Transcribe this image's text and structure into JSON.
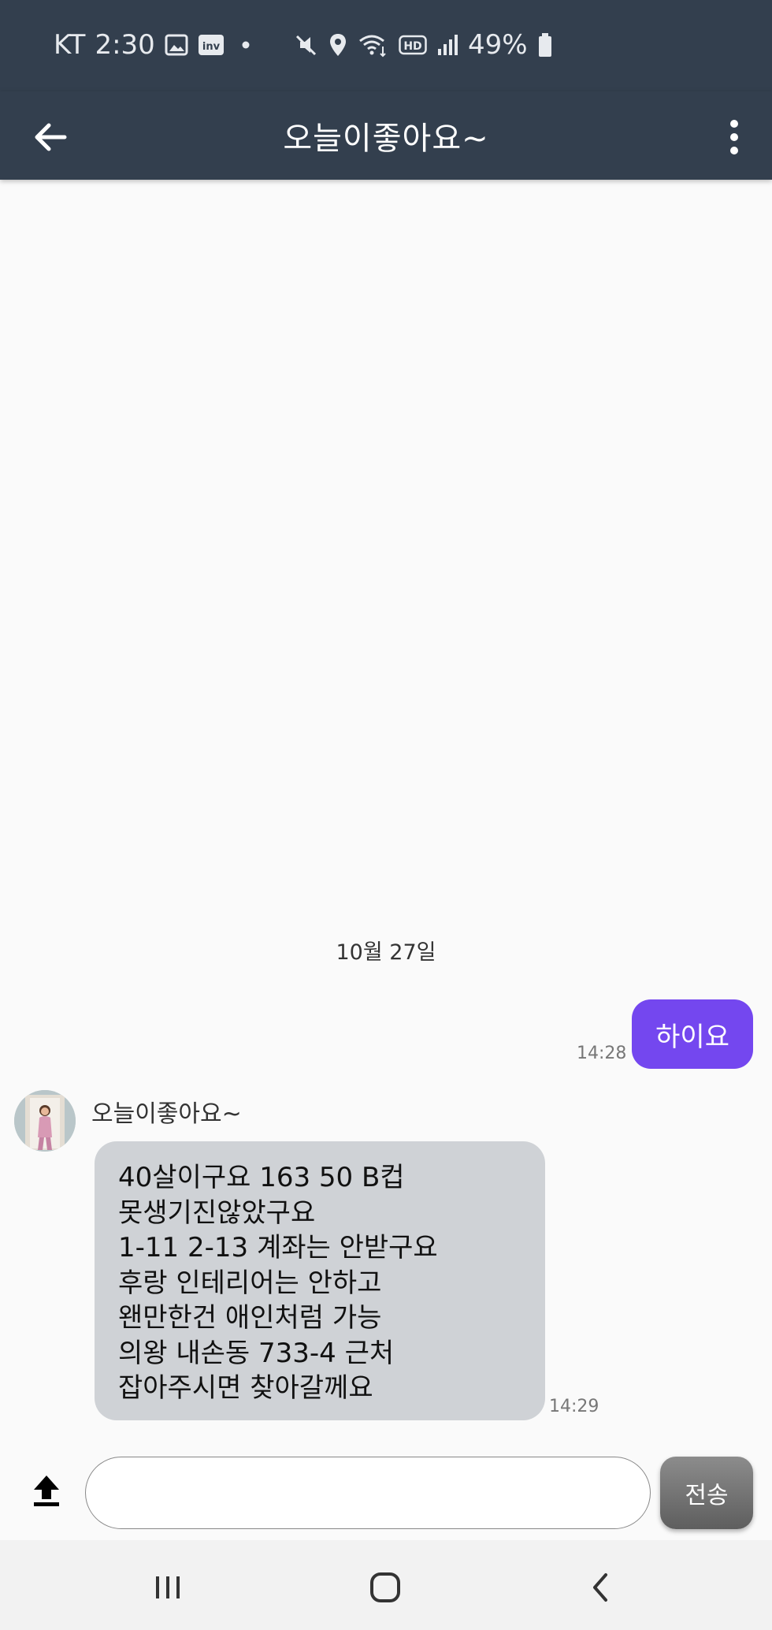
{
  "status_bar": {
    "carrier": "KT",
    "time": "2:30",
    "battery_percent": "49%",
    "icons": [
      "gallery-icon",
      "inv-app-icon",
      "dot-icon",
      "mute-icon",
      "location-icon",
      "wifi-icon",
      "hd-voice-icon",
      "signal-icon",
      "battery-icon"
    ]
  },
  "app_bar": {
    "title": "오늘이좋아요~",
    "icons": [
      "back-arrow-icon",
      "more-vertical-icon"
    ]
  },
  "chat": {
    "date_separator": "10월 27일",
    "outgoing": {
      "text": "하이요",
      "time": "14:28",
      "color": "#7447ef"
    },
    "incoming": {
      "sender": "오늘이좋아요~",
      "lines": [
        "40살이구요 163 50 B컵",
        "못생기진않았구요",
        "1-11 2-13 계좌는 안받구요",
        "후랑 인테리어는 안하고",
        "왠만한건 애인처럼 가능",
        "의왕 내손동 733-4 근처",
        "잡아주시면 찾아갈께요"
      ],
      "time": "14:29",
      "color": "#cfd2d6"
    }
  },
  "composer": {
    "input_value": "",
    "input_placeholder": "",
    "send_label": "전송",
    "icons": [
      "upload-icon"
    ]
  },
  "nav_bar": {
    "icons": [
      "recent-apps-icon",
      "home-icon",
      "back-icon"
    ]
  },
  "colors": {
    "header_bg": "#333f4e",
    "background": "#fafafa",
    "accent": "#7447ef"
  }
}
